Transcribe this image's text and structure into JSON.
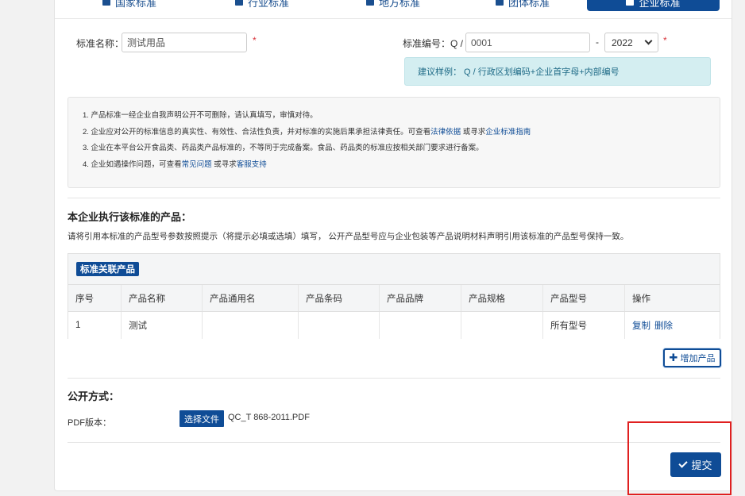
{
  "tabs": [
    {
      "label": "国家标准",
      "icon": "document-icon"
    },
    {
      "label": "行业标准",
      "icon": "flag-icon"
    },
    {
      "label": "地方标准",
      "icon": "document-icon"
    },
    {
      "label": "团体标准",
      "icon": "tag-icon"
    },
    {
      "label": "企业标准",
      "icon": "building-icon",
      "active": true
    }
  ],
  "form": {
    "name_label": "标准名称：",
    "name_value": "测试用品",
    "code_label": "标准编号：Q /",
    "code_value": "0001",
    "dash": "-",
    "year_value": "2022",
    "required_mark": "*",
    "hint": "建议样例： Q / 行政区划编码+企业首字母+内部编号"
  },
  "notes": {
    "n1": "1. 产品标准一经企业自我声明公开不可删除，请认真填写，审慎对待。",
    "n2_pre": "2. 企业应对公开的标准信息的真实性、有效性、合法性负责，并对标准的实施后果承担法律责任。可查看",
    "n2_link1": "法律依据",
    "n2_mid": " 或寻求",
    "n2_link2": "企业标准指南",
    "n3": "3. 企业在本平台公开食品类、药品类产品标准的，不等同于完成备案。食品、药品类的标准应按相关部门要求进行备案。",
    "n4_pre": "4. 企业如遇操作问题，可查看",
    "n4_link1": "常见问题",
    "n4_mid": " 或寻求",
    "n4_link2": "客服支持"
  },
  "products": {
    "title": "本企业执行该标准的产品：",
    "desc": "请将引用本标准的产品型号参数按照提示（将提示必填或选填）填写， 公开产品型号应与企业包装等产品说明材料声明引用该标准的产品型号保持一致。",
    "badge": "标准关联产品",
    "columns": [
      "序号",
      "产品名称",
      "产品通用名",
      "产品条码",
      "产品品牌",
      "产品规格",
      "产品型号",
      "操作"
    ],
    "rows": [
      {
        "no": "1",
        "name": "测试",
        "common": "",
        "barcode": "",
        "brand": "",
        "spec": "",
        "model": "所有型号",
        "copy": "复制",
        "delete": "删除"
      }
    ],
    "add_button": "增加产品"
  },
  "publish": {
    "title": "公开方式：",
    "pdf_label": "PDF版本：",
    "choose_file": "选择文件",
    "file_name": "QC_T 868-2011.PDF"
  },
  "submit_label": "提交",
  "colors": {
    "primary": "#0f4c96",
    "hint_bg": "#d4eef1",
    "highlight": "#e02020"
  }
}
